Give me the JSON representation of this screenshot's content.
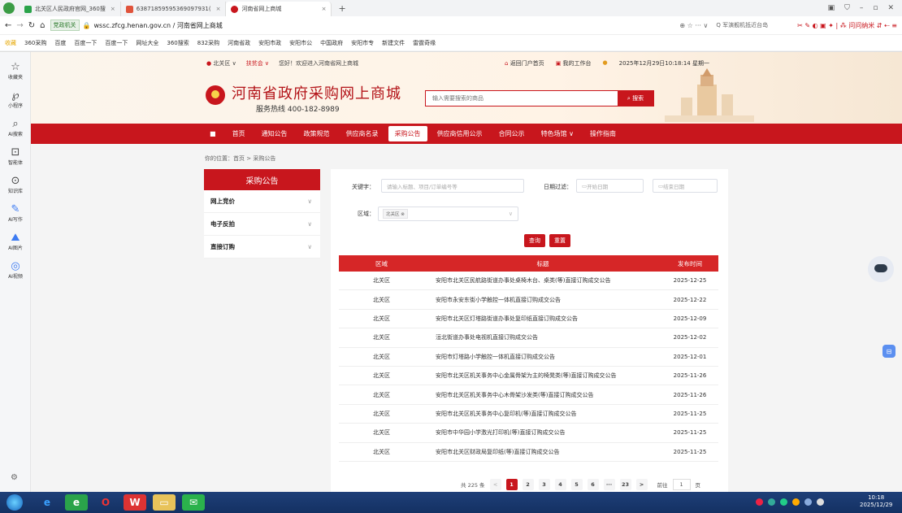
{
  "browser": {
    "tabs": [
      {
        "label": "北关区人民政府官网_360搜"
      },
      {
        "label": "63871859595369097931("
      },
      {
        "label": "河南省网上商城"
      }
    ],
    "new_tab": "+",
    "url_gov_badge": "党政机关",
    "url": "wssc.zfcg.henan.gov.cn / 河南省网上商城",
    "search_hint": "军演舰机抵近台岛",
    "bookmarks": [
      "收藏",
      "360采购",
      "百度",
      "百度一下",
      "百度一下",
      "网址大全",
      "360搜索",
      "832采购",
      "河南省政",
      "安阳市政",
      "安阳市公",
      "中国政府",
      "安阳市专",
      "新建文件",
      "雷霆奇缘"
    ]
  },
  "sidebar": {
    "items": [
      {
        "icon": "star-icon",
        "label": "收藏夹"
      },
      {
        "icon": "mini-program-icon",
        "label": "小程序"
      },
      {
        "icon": "search-icon",
        "label": "AI搜索"
      },
      {
        "icon": "agent-icon",
        "label": "智能体"
      },
      {
        "icon": "knowledge-icon",
        "label": "知识库"
      },
      {
        "icon": "write-icon",
        "label": "AI写作"
      },
      {
        "icon": "image-icon",
        "label": "AI图片"
      },
      {
        "icon": "video-icon",
        "label": "AI视频"
      }
    ]
  },
  "header": {
    "location": "北关区",
    "location_chevron": "∨",
    "sub_site": "扶贫会",
    "greeting": "您好！欢迎进入河南省网上商城",
    "link_portal": "返回门户首页",
    "link_workbench": "我的工作台",
    "datetime": "2025年12月29日10:18:14 星期一",
    "site_name": "河南省政府采购网上商城",
    "hotline": "服务热线  400-182-8989",
    "search_placeholder": "输入需要搜索的商品",
    "search_button": "搜索"
  },
  "mainnav": {
    "items": [
      "首页",
      "通知公告",
      "政策规范",
      "供应商名录",
      "采购公告",
      "供应商信用公示",
      "合同公示",
      "特色场馆 ∨",
      "操作指南"
    ],
    "active": "采购公告"
  },
  "breadcrumb": "你的位置：首页 > 采购公告",
  "leftmenu": {
    "title": "采购公告",
    "items": [
      {
        "label": "网上竞价"
      },
      {
        "label": "电子反拍"
      },
      {
        "label": "直接订购"
      }
    ]
  },
  "filters": {
    "keyword_label": "关键字：",
    "keyword_placeholder": "请输入标题、项目/订单编号等",
    "date_label": "日期过滤：",
    "date_start_placeholder": "开始日期",
    "date_end_placeholder": "结束日期",
    "region_label": "区域：",
    "region_tag": "北关区 ⊗",
    "query_button": "查询",
    "reset_button": "重置"
  },
  "table": {
    "headers": [
      "区域",
      "标题",
      "发布时间"
    ],
    "rows": [
      {
        "region": "北关区",
        "title": "安阳市北关区民航路街道办事处桌椅木台、桌类(等)直接订购成交公告",
        "date": "2025-12-25"
      },
      {
        "region": "北关区",
        "title": "安阳市永安东街小学触控一体机直接订购成交公告",
        "date": "2025-12-22"
      },
      {
        "region": "北关区",
        "title": "安阳市北关区灯塔路街道办事处复印纸直接订购成交公告",
        "date": "2025-12-09"
      },
      {
        "region": "北关区",
        "title": "洹北街道办事处电视机直接订购成交公告",
        "date": "2025-12-02"
      },
      {
        "region": "北关区",
        "title": "安阳市灯塔路小学触控一体机直接订购成交公告",
        "date": "2025-12-01"
      },
      {
        "region": "北关区",
        "title": "安阳市北关区机关事务中心金属骨架为主的椅凳类(等)直接订购成交公告",
        "date": "2025-11-26"
      },
      {
        "region": "北关区",
        "title": "安阳市北关区机关事务中心木骨架沙发类(等)直接订购成交公告",
        "date": "2025-11-26"
      },
      {
        "region": "北关区",
        "title": "安阳市北关区机关事务中心复印机(等)直接订购成交公告",
        "date": "2025-11-25"
      },
      {
        "region": "北关区",
        "title": "安阳市中华园小学激光打印机(等)直接订购成交公告",
        "date": "2025-11-25"
      },
      {
        "region": "北关区",
        "title": "安阳市北关区财政局复印纸(等)直接订购成交公告",
        "date": "2025-11-25"
      }
    ]
  },
  "pager": {
    "total": "共 225 条",
    "prev": "<",
    "pages": [
      "1",
      "2",
      "3",
      "4",
      "5",
      "6",
      "···",
      "23"
    ],
    "active": "1",
    "next": ">",
    "goto_label": "前往",
    "goto_value": "1",
    "goto_suffix": "页"
  },
  "taskbar": {
    "time": "10:18",
    "date": "2025/12/29"
  },
  "colors": {
    "brand_red": "#c8161d",
    "table_header": "#d62627",
    "taskbar": "#1e3f78"
  }
}
